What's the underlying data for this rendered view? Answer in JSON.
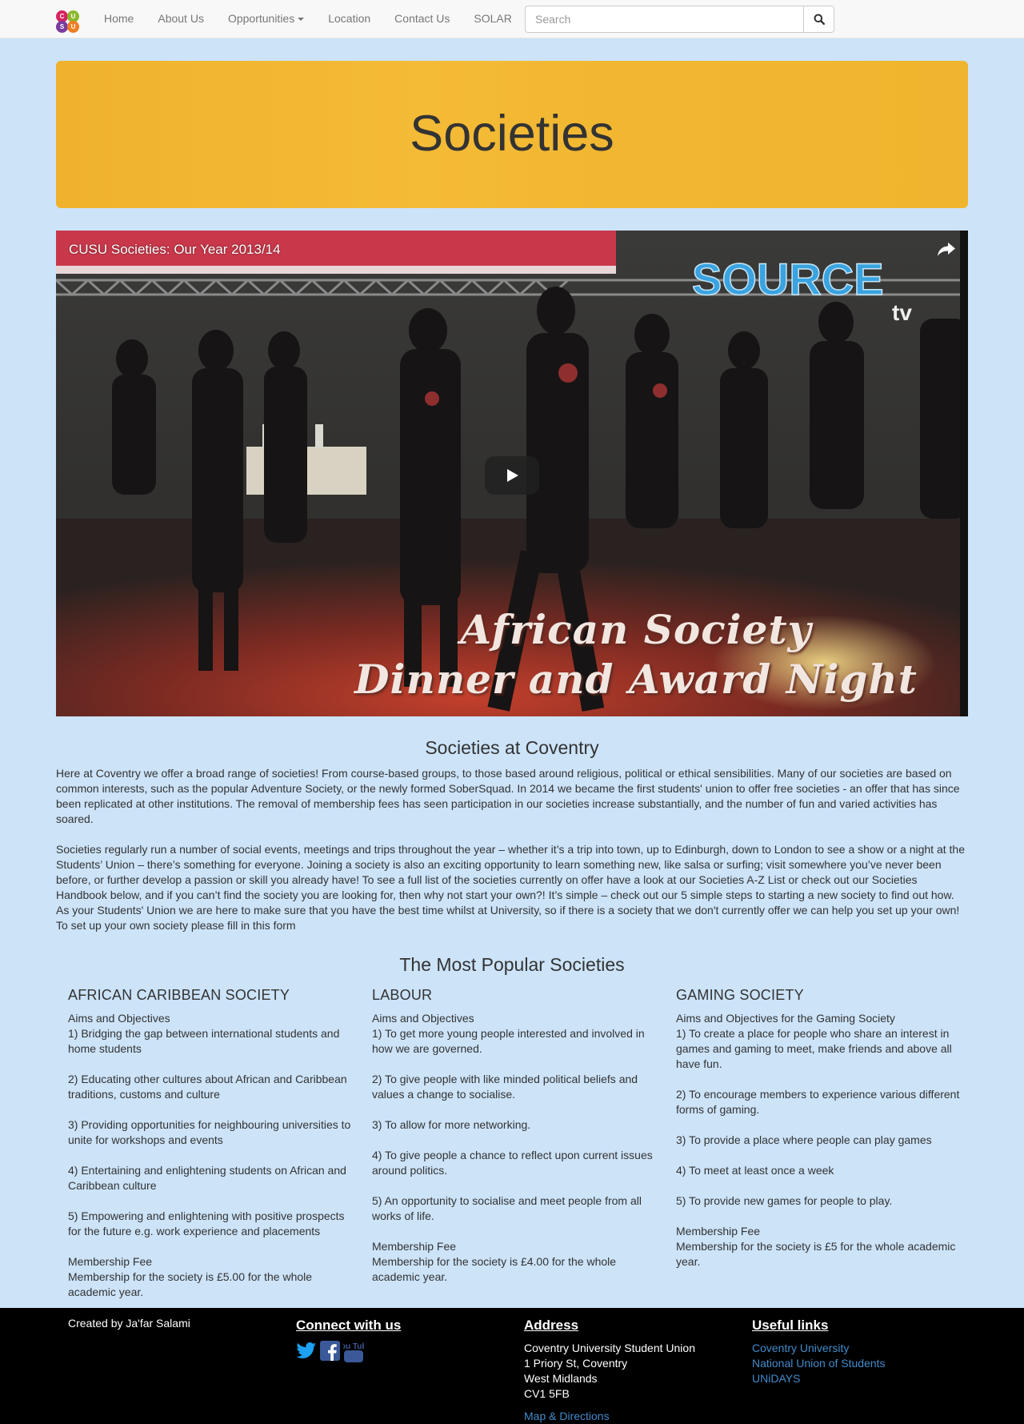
{
  "nav": {
    "logo_letters": [
      "C",
      "U",
      "S",
      "U"
    ],
    "items": [
      {
        "label": "Home"
      },
      {
        "label": "About Us"
      },
      {
        "label": "Opportunities"
      },
      {
        "label": "Location"
      },
      {
        "label": "Contact Us"
      },
      {
        "label": "SOLAR"
      }
    ],
    "search_placeholder": "Search"
  },
  "hero": {
    "title": "Societies"
  },
  "video": {
    "title": "CUSU Societies: Our Year 2013/14",
    "caption_line1": "African Society",
    "caption_line2": "Dinner and Award Night",
    "brand": "SOURCE",
    "brand_sub": "tv"
  },
  "intro": {
    "title": "Societies at Coventry",
    "paragraph1": "Here at Coventry we offer a broad range of societies! From course-based groups, to those based around religious, political or ethical sensibilities. Many of our societies are based on common interests, such as the popular Adventure Society, or the newly formed SoberSquad. In 2014 we became the first students' union to offer free societies - an offer that has since been replicated at other institutions. The removal of membership fees has seen participation in our societies increase substantially, and the number of fun and varied activities has soared.",
    "paragraph2": "Societies regularly run a number of social events, meetings and trips throughout the year – whether it’s a trip into town, up to Edinburgh, down to London to see a show or a night at the Students’ Union – there’s something for everyone. Joining a society is also an exciting opportunity to learn something new, like salsa or surfing; visit somewhere you’ve never been before, or further develop a passion or skill you already have! To see a full list of the societies currently on offer have a look at our Societies A-Z List or check out our Societies Handbook below, and if you can’t find the society you are looking for, then why not start your own?! It’s simple – check out our 5 simple steps to starting a new society to find out how. As your Students' Union we are here to make sure that you have the best time whilst at University, so if there is a society that we don't currently offer we can help you set up your own! To set up your own society please fill in this form"
  },
  "popular": {
    "title": "The Most Popular Societies",
    "societies": [
      {
        "name": "AFRICAN CARIBBEAN SOCIETY",
        "aims_heading": "Aims and Objectives",
        "aims": [
          "1) Bridging the gap between international students and home students",
          "2) Educating other cultures about African and Caribbean traditions, customs and culture",
          "3) Providing opportunities for neighbouring universities to unite for workshops and events",
          "4) Entertaining and enlightening students on African and Caribbean culture",
          "5) Empowering and enlightening with positive prospects for the future e.g. work experience and placements"
        ],
        "fee_heading": "Membership Fee",
        "fee_text": "Membership for the society is £5.00 for the whole academic year."
      },
      {
        "name": "LABOUR",
        "aims_heading": "Aims and Objectives",
        "aims": [
          "1) To get more young people interested and involved in how we are governed.",
          "2) To give people with like minded political beliefs and values a change to socialise.",
          "3) To allow for more networking.",
          "4) To give people a chance to reflect upon current issues around politics.",
          "5) An opportunity to socialise and meet people from all works of life."
        ],
        "fee_heading": "Membership Fee",
        "fee_text": "Membership for the society is £4.00 for the whole academic year."
      },
      {
        "name": "GAMING SOCIETY",
        "aims_heading": "Aims and Objectives for the Gaming Society",
        "aims": [
          "1) To create a place for people who share an interest in games and gaming to meet, make friends and above all have fun.",
          "2) To encourage members to experience various different forms of gaming.",
          "3) To provide a place where people can play games",
          "4) To meet at least once a week",
          "5) To provide new games for people to play."
        ],
        "fee_heading": "Membership Fee",
        "fee_text": "Membership for the society is £5 for the whole academic year."
      }
    ]
  },
  "footer": {
    "credit": "Created by Ja'far Salami",
    "connect_heading": "Connect with us",
    "social_icons": [
      "twitter-icon",
      "facebook-icon",
      "youtube-icon"
    ],
    "youtube_text": "You Tube",
    "address_heading": "Address",
    "address_lines": [
      "Coventry University Student Union",
      "1 Priory St, Coventry",
      "West Midlands",
      "CV1 5FB"
    ],
    "map_link": "Map & Directions",
    "links_heading": "Useful links",
    "links": [
      "Coventry University",
      "National Union of Students",
      "UNiDAYS"
    ]
  },
  "colors": {
    "page_bg": "#cce3f8",
    "hero_bg": "#f2b731",
    "link": "#428bca",
    "twitter": "#1da1f2",
    "facebook": "#3b5998",
    "youtube": "#3b5998"
  }
}
